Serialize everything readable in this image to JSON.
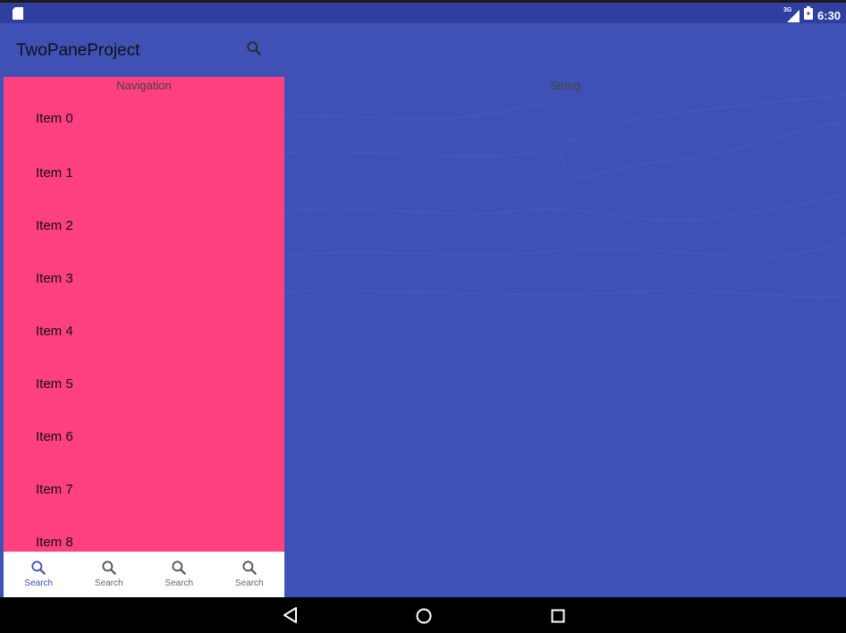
{
  "status_bar": {
    "time": "6:30",
    "network_label": "3G",
    "icons": [
      "sd-card-icon",
      "signal-icon",
      "battery-icon"
    ]
  },
  "toolbar": {
    "title": "TwoPaneProject",
    "search_icon": "search-icon"
  },
  "left_pane": {
    "header": "Navigation",
    "items": [
      "Item 0",
      "Item 1",
      "Item 2",
      "Item 3",
      "Item 4",
      "Item 5",
      "Item 6",
      "Item 7",
      "Item 8"
    ]
  },
  "right_pane": {
    "header": "String"
  },
  "bottom_nav": {
    "items": [
      {
        "label": "Search",
        "icon": "search-icon",
        "active": true
      },
      {
        "label": "Search",
        "icon": "search-icon",
        "active": false
      },
      {
        "label": "Search",
        "icon": "search-icon",
        "active": false
      },
      {
        "label": "Search",
        "icon": "search-icon",
        "active": false
      }
    ]
  },
  "system_nav": {
    "buttons": [
      "back-icon",
      "home-icon",
      "recents-icon"
    ]
  },
  "colors": {
    "primary": "#3f51b5",
    "primary_dark": "#303f9f",
    "accent": "#ff4081"
  }
}
